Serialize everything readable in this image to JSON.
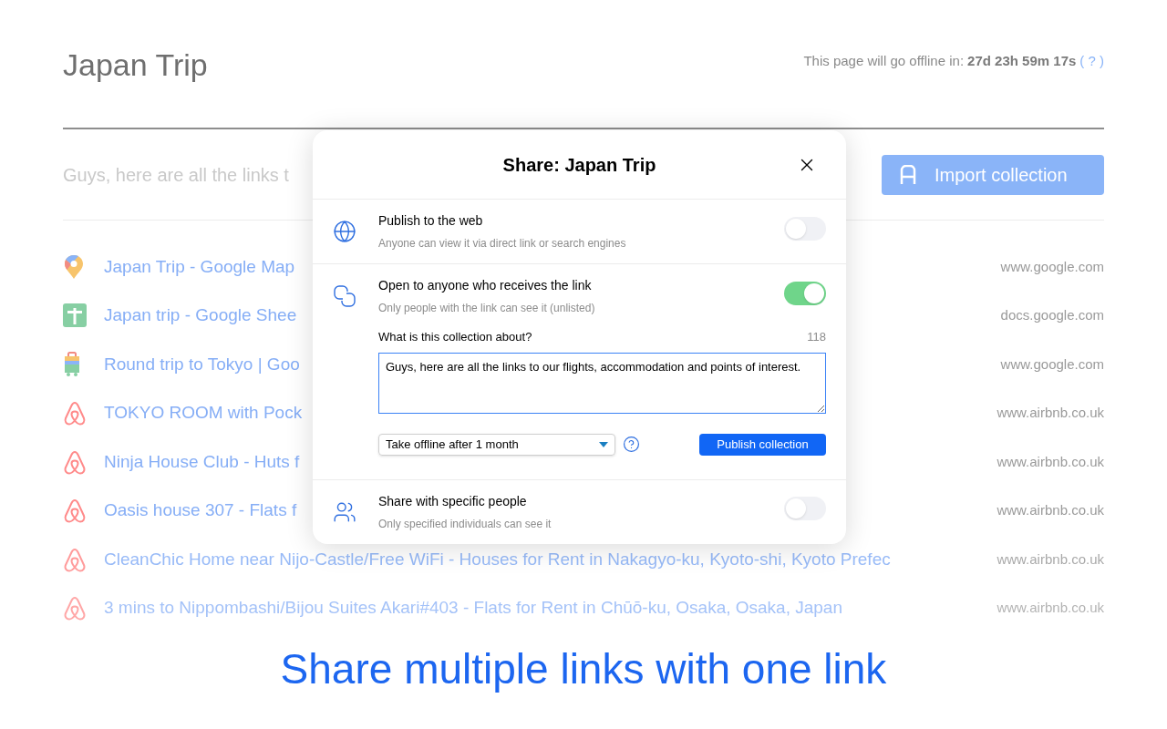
{
  "page": {
    "title": "Japan Trip",
    "offline_label": "This page will go offline in:",
    "countdown": "27d 23h 59m 17s",
    "help": "( ? )"
  },
  "description": "Guys, here are all the links t",
  "import_button": "Import collection",
  "links": [
    {
      "kind": "maps",
      "title": "Japan Trip - Google Map",
      "domain": "www.google.com"
    },
    {
      "kind": "sheets",
      "title": "Japan trip - Google Shee",
      "domain": "docs.google.com"
    },
    {
      "kind": "travel",
      "title": "Round trip to Tokyo | Goo",
      "domain": "www.google.com"
    },
    {
      "kind": "airbnb",
      "title": "TOKYO ROOM with Pock",
      "domain": "www.airbnb.co.uk"
    },
    {
      "kind": "airbnb",
      "title": "Ninja House Club - Huts f",
      "domain": "www.airbnb.co.uk"
    },
    {
      "kind": "airbnb",
      "title": "Oasis house 307 - Flats f",
      "domain": "www.airbnb.co.uk"
    },
    {
      "kind": "airbnb",
      "title": "CleanChic Home near Nijo-Castle/Free WiFi - Houses for Rent in Nakagyo-ku, Kyoto-shi, Kyoto Prefec",
      "domain": "www.airbnb.co.uk"
    },
    {
      "kind": "airbnb",
      "title": "3 mins to Nippombashi/Bijou Suites Akari#403 - Flats for Rent in Chūō-ku, Osaka, Osaka, Japan",
      "domain": "www.airbnb.co.uk"
    }
  ],
  "dialog": {
    "title": "Share: Japan Trip",
    "options": [
      {
        "kind": "globe",
        "title": "Publish to the web",
        "subtitle": "Anyone can view it via direct link or search engines",
        "on": false
      },
      {
        "kind": "link",
        "title": "Open to anyone who receives the link",
        "subtitle": "Only people with the link can see it (unlisted)",
        "on": true,
        "form": {
          "label": "What is this collection about?",
          "count": "118",
          "value": "Guys, here are all the links to our flights, accommodation and points of interest.",
          "expiry": "Take offline after 1 month",
          "publish_button": "Publish collection"
        }
      },
      {
        "kind": "people",
        "title": "Share with specific people",
        "subtitle": "Only specified individuals can see it",
        "on": false
      }
    ]
  },
  "caption": "Share multiple links with one link"
}
